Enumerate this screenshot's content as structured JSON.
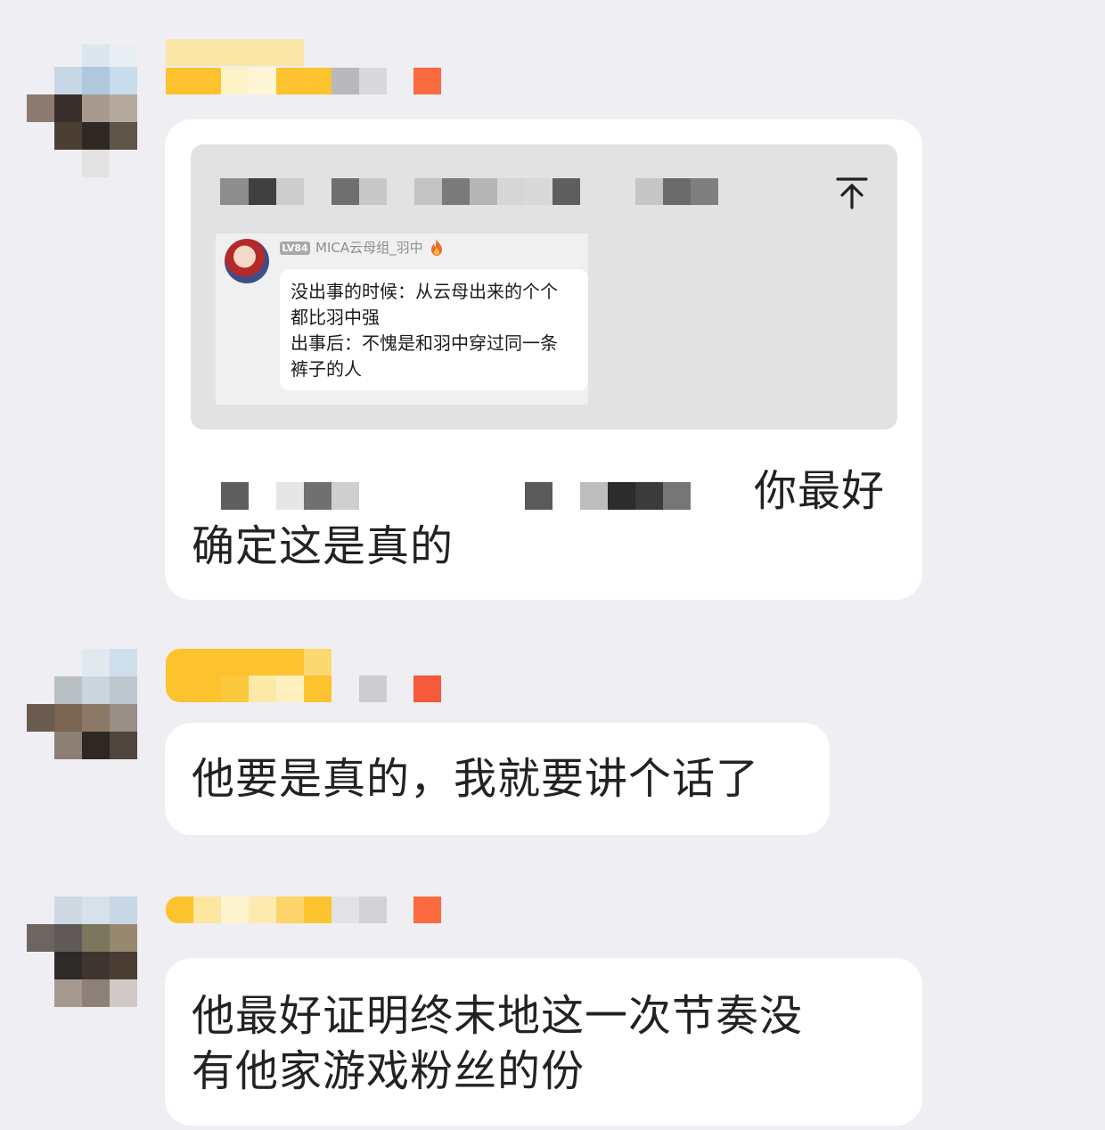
{
  "colors": {
    "background": "#efeef3",
    "bubble": "#ffffff",
    "text": "#222222",
    "name_yellow": "#fcc32f",
    "badge_orange": "#fb6b3f"
  },
  "messages": [
    {
      "id": "msg1",
      "quote": {
        "inner_post": {
          "level_badge": "LV84",
          "username": "MICA云母组_羽中",
          "lines": [
            "没出事的时候：从云母出来的个个",
            "都比羽中强",
            "出事后：不愧是和羽中穿过同一条",
            "裤子的人"
          ]
        },
        "scroll_icon": "arrow-up-to-top-icon"
      },
      "text_line1_tail": "你最好",
      "text_line2": "确定这是真的"
    },
    {
      "id": "msg2",
      "text_line1": "他要是真的，我就要讲个话了"
    },
    {
      "id": "msg3",
      "text_line1": "他最好证明终末地这一次节奏没",
      "text_line2": "有他家游戏粉丝的份"
    }
  ]
}
